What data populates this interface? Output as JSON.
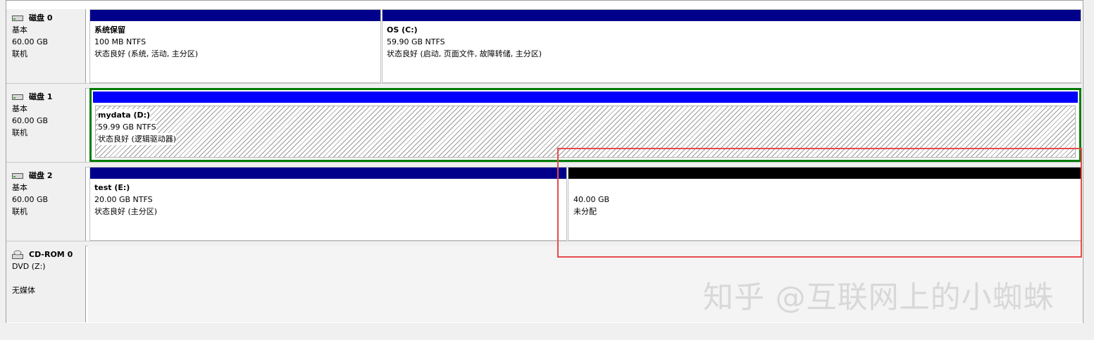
{
  "disks": [
    {
      "name": "磁盘 0",
      "type": "基本",
      "size": "60.00 GB",
      "status": "联机",
      "partitions": [
        {
          "name": "系统保留",
          "size_fs": "100 MB NTFS",
          "state": "状态良好 (系统, 活动, 主分区)"
        },
        {
          "name": "OS  (C:)",
          "size_fs": "59.90 GB NTFS",
          "state": "状态良好 (启动, 页面文件, 故障转储, 主分区)"
        }
      ]
    },
    {
      "name": "磁盘 1",
      "type": "基本",
      "size": "60.00 GB",
      "status": "联机",
      "partitions": [
        {
          "name": "mydata  (D:)",
          "size_fs": "59.99 GB NTFS",
          "state": "状态良好 (逻辑驱动器)"
        }
      ]
    },
    {
      "name": "磁盘 2",
      "type": "基本",
      "size": "60.00 GB",
      "status": "联机",
      "partitions": [
        {
          "name": "test  (E:)",
          "size_fs": "20.00 GB NTFS",
          "state": "状态良好 (主分区)"
        },
        {
          "name": "",
          "size_fs": "40.00 GB",
          "state": "未分配"
        }
      ]
    }
  ],
  "cdrom": {
    "name": "CD-ROM 0",
    "drive": "DVD (Z:)",
    "media": "无媒体"
  },
  "watermark": "知乎 @互联网上的小蜘蛛",
  "colors": {
    "primary_bar": "#00008b",
    "logical_bar": "#0000ff",
    "unallocated_bar": "#000000",
    "selection": "#007a00",
    "highlight": "#e64b4b"
  }
}
